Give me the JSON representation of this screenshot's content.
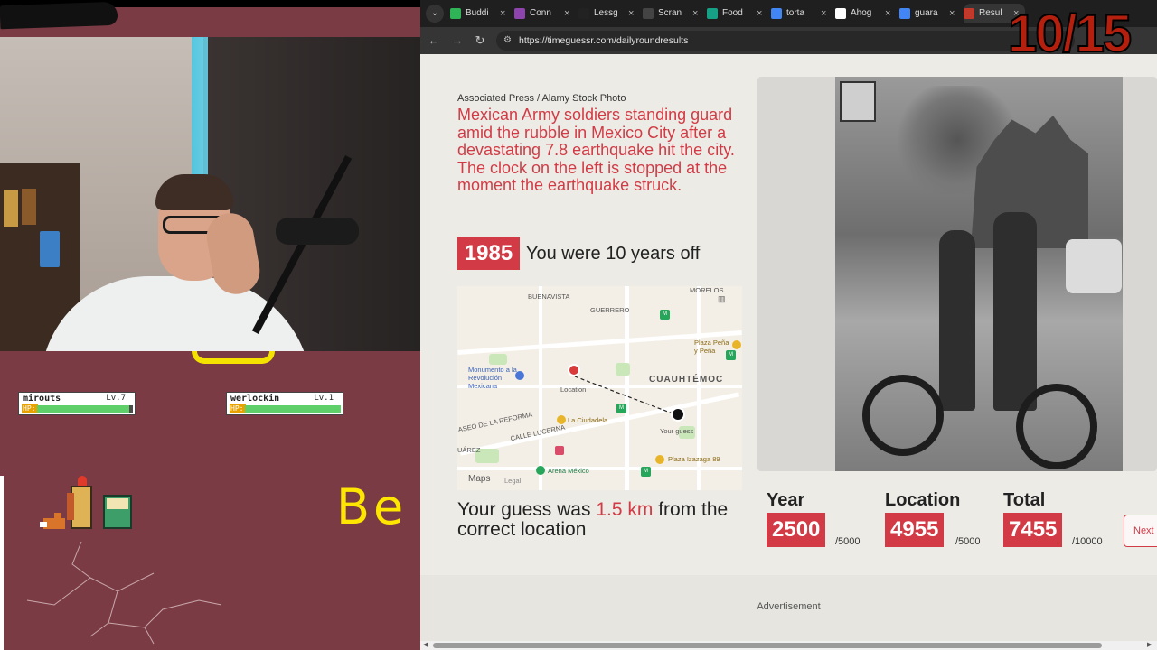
{
  "stream": {
    "players": [
      {
        "name": "mirouts",
        "level": "Lv.7",
        "hp_label": "HP:",
        "hp_fraction": 0.96
      },
      {
        "name": "werlockin",
        "level": "Lv.1",
        "hp_label": "HP:",
        "hp_fraction": 1.0
      }
    ],
    "whiteboard_text": "Be",
    "round_counter": "10/15"
  },
  "browser": {
    "tabs": [
      {
        "label": "Buddi",
        "icon": "k-icon",
        "color": "#2fb457"
      },
      {
        "label": "Conn",
        "icon": "grid-icon",
        "color": "#8e44ad"
      },
      {
        "label": "Lessg",
        "icon": "chevron-icon",
        "color": "#222222"
      },
      {
        "label": "Scran",
        "icon": "pen-icon",
        "color": "#444444"
      },
      {
        "label": "Food",
        "icon": "food-icon",
        "color": "#16a085"
      },
      {
        "label": "torta",
        "icon": "google-icon",
        "color": "#4285f4"
      },
      {
        "label": "Ahog",
        "icon": "wikipedia-icon",
        "color": "#ffffff"
      },
      {
        "label": "guara",
        "icon": "google-icon",
        "color": "#4285f4"
      },
      {
        "label": "Resul",
        "icon": "timeguessr-icon",
        "color": "#c0392b"
      }
    ],
    "url": "https://timeguessr.com/dailyroundresults"
  },
  "result": {
    "attribution": "Associated Press / Alamy Stock Photo",
    "caption": "Mexican Army soldiers standing guard amid the rubble in Mexico City after a devastating 7.8 earthquake hit the city. The clock on the left is stopped at the moment the earthquake struck.",
    "year": "1985",
    "years_off_text": "You were 10 years off",
    "guess_prefix": "Your guess was",
    "guess_distance": "1.5 km",
    "guess_suffix": "from the correct location",
    "map": {
      "labels": {
        "buenavista": "BUENAVISTA",
        "guerrero": "GUERRERO",
        "morelos": "MORELOS",
        "cuauhtemoc": "CUAUHTÉMOC",
        "plaza_pena": "Plaza Peña y Peña",
        "monumento": "Monumento a la Revolución Mexicana",
        "location": "Location",
        "your_guess": "Your guess",
        "reforma": "ASEO DE LA REFORMA",
        "ciudadela": "La Ciudadela",
        "lucerna": "CALLE LUCERNA",
        "juarez": "UÁREZ",
        "arena": "Arena México",
        "izazaga": "Plaza Izazaga 89",
        "maps_brand": "Maps",
        "legal": "Legal"
      }
    },
    "scores": [
      {
        "title": "Year",
        "value": "2500",
        "max": "/5000"
      },
      {
        "title": "Location",
        "value": "4955",
        "max": "/5000"
      },
      {
        "title": "Total",
        "value": "7455",
        "max": "/10000"
      }
    ],
    "next_label": "Next",
    "ad_label": "Advertisement"
  }
}
